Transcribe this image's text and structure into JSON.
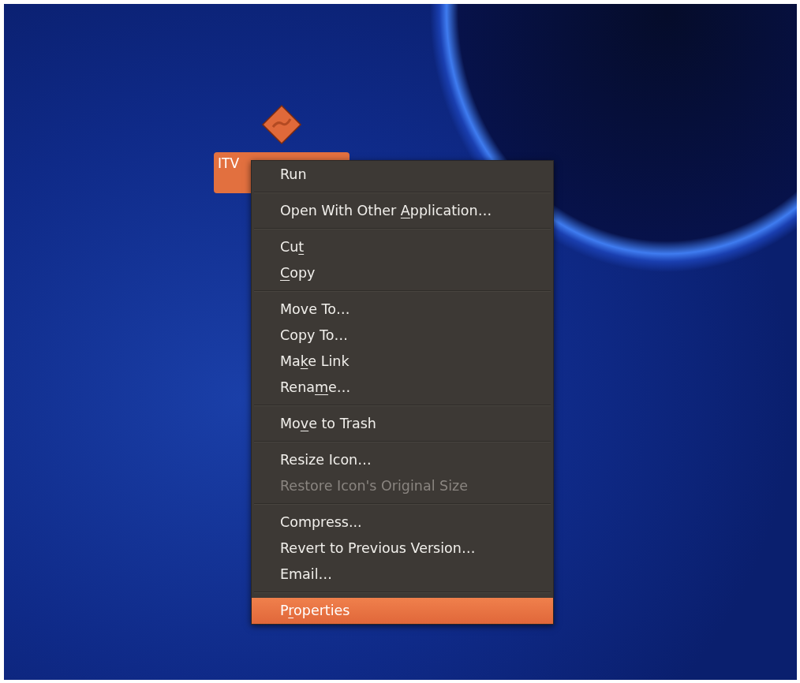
{
  "desktop": {
    "icon": {
      "label": "ITV",
      "selected": true
    }
  },
  "context_menu": {
    "sections": [
      [
        {
          "label": [
            {
              "text": "Run",
              "underline": false
            }
          ],
          "disabled": false,
          "selected": false
        }
      ],
      [
        {
          "label": [
            {
              "text": "Open With Other ",
              "underline": false
            },
            {
              "text": "A",
              "underline": true
            },
            {
              "text": "pplication…",
              "underline": false
            }
          ],
          "disabled": false,
          "selected": false
        }
      ],
      [
        {
          "label": [
            {
              "text": "Cu",
              "underline": false
            },
            {
              "text": "t",
              "underline": true
            }
          ],
          "disabled": false,
          "selected": false
        },
        {
          "label": [
            {
              "text": "C",
              "underline": true
            },
            {
              "text": "opy",
              "underline": false
            }
          ],
          "disabled": false,
          "selected": false
        }
      ],
      [
        {
          "label": [
            {
              "text": "Move To…",
              "underline": false
            }
          ],
          "disabled": false,
          "selected": false
        },
        {
          "label": [
            {
              "text": "Copy To…",
              "underline": false
            }
          ],
          "disabled": false,
          "selected": false
        },
        {
          "label": [
            {
              "text": "Ma",
              "underline": false
            },
            {
              "text": "k",
              "underline": true
            },
            {
              "text": "e Link",
              "underline": false
            }
          ],
          "disabled": false,
          "selected": false
        },
        {
          "label": [
            {
              "text": "Rena",
              "underline": false
            },
            {
              "text": "m",
              "underline": true
            },
            {
              "text": "e…",
              "underline": false
            }
          ],
          "disabled": false,
          "selected": false
        }
      ],
      [
        {
          "label": [
            {
              "text": "Mo",
              "underline": false
            },
            {
              "text": "v",
              "underline": true
            },
            {
              "text": "e to Trash",
              "underline": false
            }
          ],
          "disabled": false,
          "selected": false
        }
      ],
      [
        {
          "label": [
            {
              "text": "Resize Icon…",
              "underline": false
            }
          ],
          "disabled": false,
          "selected": false
        },
        {
          "label": [
            {
              "text": "Restore Icon's Original Size",
              "underline": false
            }
          ],
          "disabled": true,
          "selected": false
        }
      ],
      [
        {
          "label": [
            {
              "text": "Compress...",
              "underline": false
            }
          ],
          "disabled": false,
          "selected": false
        },
        {
          "label": [
            {
              "text": "Revert to Previous Version…",
              "underline": false
            }
          ],
          "disabled": false,
          "selected": false
        },
        {
          "label": [
            {
              "text": "Email…",
              "underline": false
            }
          ],
          "disabled": false,
          "selected": false
        }
      ],
      [
        {
          "label": [
            {
              "text": "P",
              "underline": false
            },
            {
              "text": "r",
              "underline": true
            },
            {
              "text": "operties",
              "underline": false
            }
          ],
          "disabled": false,
          "selected": true
        }
      ]
    ]
  }
}
